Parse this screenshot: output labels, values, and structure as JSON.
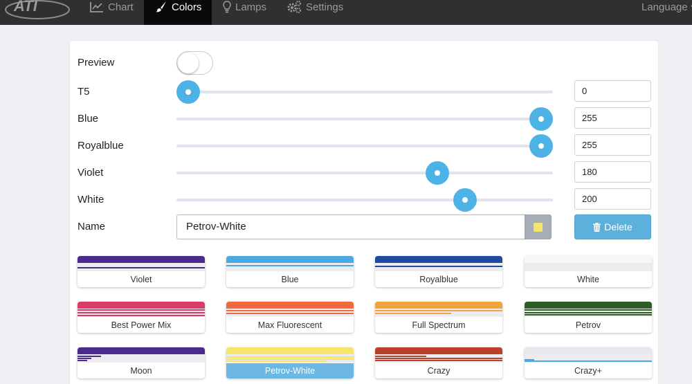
{
  "nav": {
    "logo_text": "ATI",
    "items": [
      {
        "label": "Chart",
        "icon": "line-chart-icon"
      },
      {
        "label": "Colors",
        "icon": "paint-brush-icon",
        "active": true
      },
      {
        "label": "Lamps",
        "icon": "lightbulb-icon"
      },
      {
        "label": "Settings",
        "icon": "gears-icon"
      }
    ],
    "language": "Language"
  },
  "form": {
    "preview_label": "Preview",
    "preview_on": false,
    "channels": [
      {
        "label": "T5",
        "value": "0"
      },
      {
        "label": "Blue",
        "value": "255"
      },
      {
        "label": "Royalblue",
        "value": "255"
      },
      {
        "label": "Violet",
        "value": "180"
      },
      {
        "label": "White",
        "value": "200"
      }
    ],
    "slider_max": 255,
    "name_label": "Name",
    "name_value": "Petrov-White",
    "swatch_color": "#f5e56b",
    "delete_label": "Delete"
  },
  "presets": [
    {
      "label": "Violet",
      "color": "#4b2b8c"
    },
    {
      "label": "Blue",
      "color": "#4aa9e2"
    },
    {
      "label": "Royalblue",
      "color": "#1f4aa0"
    },
    {
      "label": "White",
      "color": "#f3f3f3"
    },
    {
      "label": "Best Power Mix",
      "color": "#dc3b67"
    },
    {
      "label": "Max Fluorescent",
      "color": "#ee6a3a"
    },
    {
      "label": "Full Spectrum",
      "color": "#f2a43c"
    },
    {
      "label": "Petrov",
      "color": "#2e5e24"
    },
    {
      "label": "Moon",
      "color": "#4b2b8c"
    },
    {
      "label": "Petrov-White",
      "color": "#f5e56b",
      "active": true
    },
    {
      "label": "Crazy",
      "color": "#b9402a"
    },
    {
      "label": "Crazy+",
      "color": "#e6e8ee"
    }
  ]
}
